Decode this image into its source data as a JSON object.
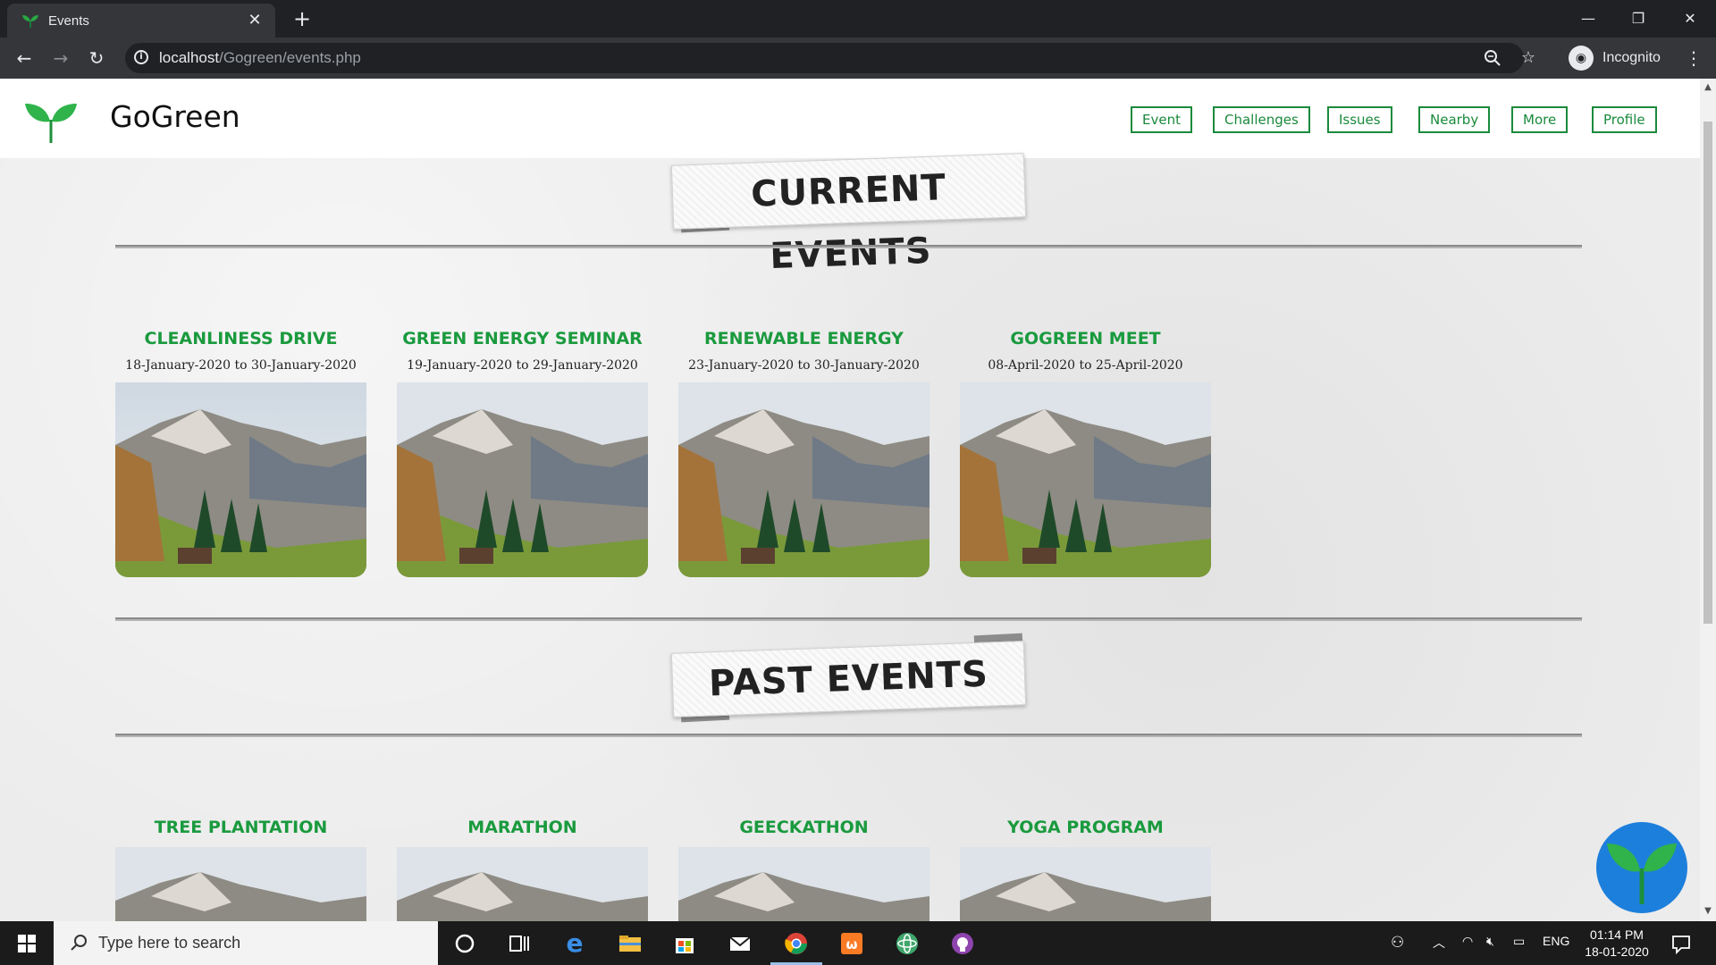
{
  "browser": {
    "tab_title": "Events",
    "url_host": "localhost",
    "url_path": "/Gogreen/events.php",
    "profile_label": "Incognito"
  },
  "site": {
    "brand": "GoGreen",
    "nav": [
      "Event",
      "Challenges",
      "Issues",
      "Nearby",
      "More",
      "Profile"
    ],
    "accent_color": "#1a9a3e"
  },
  "current_events": {
    "heading": "CURRENT EVENTS",
    "items": [
      {
        "title": "CLEANLINESS DRIVE",
        "dates": "18-January-2020 to 30-January-2020"
      },
      {
        "title": "GREEN ENERGY SEMINAR",
        "dates": "19-January-2020 to 29-January-2020"
      },
      {
        "title": "RENEWABLE ENERGY",
        "dates": "23-January-2020 to 30-January-2020"
      },
      {
        "title": "GOGREEN MEET",
        "dates": "08-April-2020 to 25-April-2020"
      }
    ]
  },
  "past_events": {
    "heading": "PAST EVENTS",
    "items": [
      {
        "title": "TREE PLANTATION"
      },
      {
        "title": "MARATHON"
      },
      {
        "title": "GEECKATHON"
      },
      {
        "title": "YOGA PROGRAM"
      }
    ]
  },
  "taskbar": {
    "search_placeholder": "Type here to search",
    "language": "ENG",
    "time": "01:14 PM",
    "date": "18-01-2020"
  }
}
